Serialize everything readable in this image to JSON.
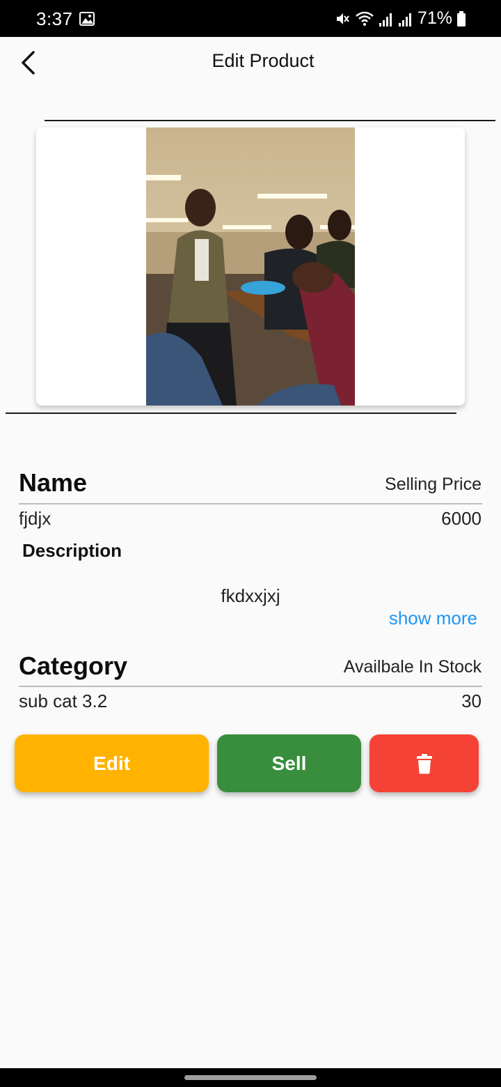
{
  "status_bar": {
    "time": "3:37",
    "battery": "71%"
  },
  "header": {
    "title": "Edit Product"
  },
  "product": {
    "name_label": "Name",
    "name_value": "fjdjx",
    "price_label": "Selling Price",
    "price_value": "6000",
    "description_label": "Description",
    "description_value": "fkdxxjxj",
    "show_more": "show more",
    "category_label": "Category",
    "category_value": "sub cat 3.2",
    "stock_label": "Availbale In Stock",
    "stock_value": "30"
  },
  "actions": {
    "edit_label": "Edit",
    "sell_label": "Sell",
    "delete_icon": "trash-icon"
  },
  "colors": {
    "edit": "#ffb300",
    "sell": "#388e3c",
    "delete": "#f44336",
    "link": "#2196f3"
  }
}
